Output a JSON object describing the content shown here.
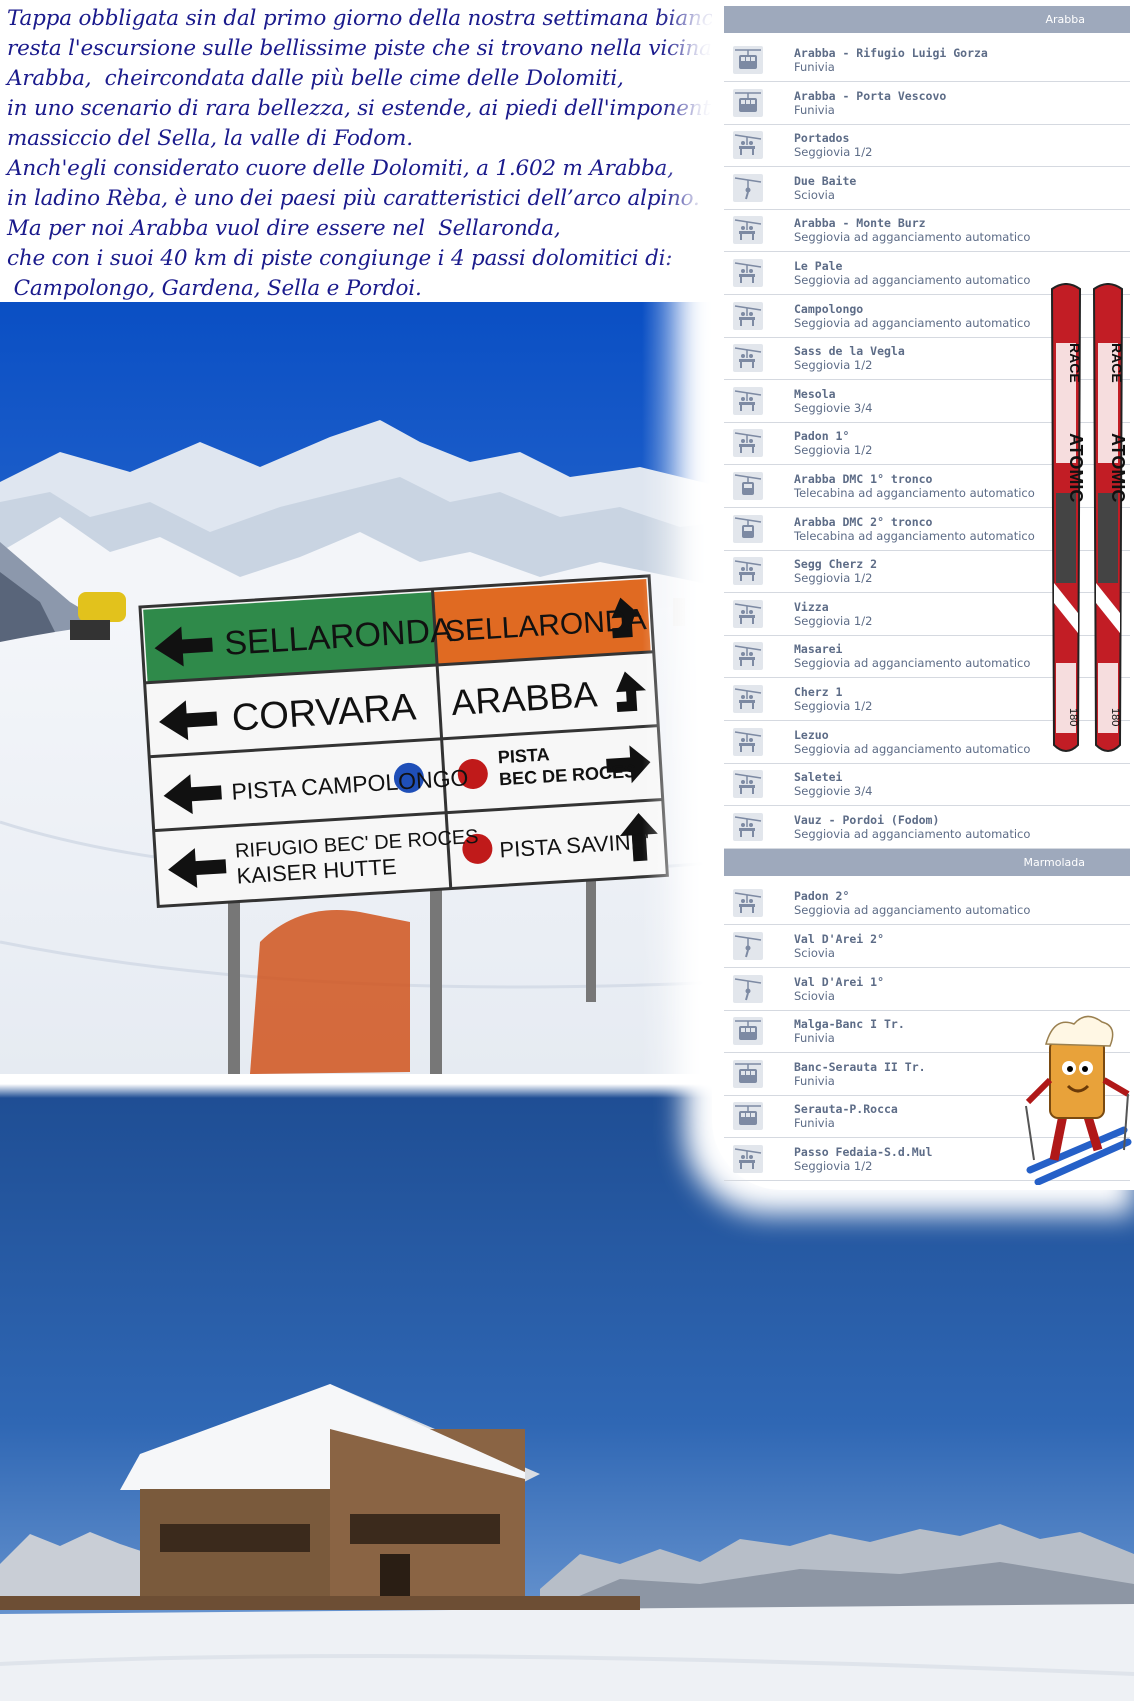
{
  "intro": {
    "lines": [
      "Tappa obbligata sin dal primo giorno della nostra settimana bianca",
      "resta l'escursione sulle bellissime piste che si trovano nella vicina",
      "Arabba,  cheircondata dalle più belle cime delle Dolomiti,",
      "in uno scenario di rara bellezza, si estende, ai piedi dell'imponente",
      "massiccio del Sella, la valle di Fodom.",
      "Anch'egli considerato cuore delle Dolomiti, a 1.602 m Arabba,",
      "in ladino Rèba, è uno dei paesi più caratteristici dell’arco alpino.",
      "Ma per noi Arabba vuol dire essere nel  Sellaronda,",
      "che con i suoi 40 km di piste congiunge i 4 passi dolomitici di:",
      " Campolongo, Gardena, Sella e Pordoi."
    ]
  },
  "signpost": {
    "left_top": "SELLARONDA",
    "right_top": "SELLARONDA",
    "left_2": "CORVARA",
    "right_2": "ARABBA",
    "left_3": "PISTA CAMPOLONGO",
    "right_3_a": "PISTA",
    "right_3_b": "BEC DE ROCES",
    "left_4_a": "RIFUGIO BEC' DE ROCES",
    "left_4_b": "KAISER HUTTE",
    "right_4": "PISTA SAVINE'",
    "colors": {
      "green": "#2f8a4a",
      "orange": "#e06a22",
      "blue": "#1f4fb8",
      "red": "#c01a1a"
    }
  },
  "lifts": {
    "groups": [
      {
        "header": "Arabba",
        "rows": [
          {
            "name": "Arabba - Rifugio Luigi Gorza",
            "type": "Funivia",
            "icon": "cable-car-icon"
          },
          {
            "name": "Arabba - Porta Vescovo",
            "type": "Funivia",
            "icon": "cable-car-icon"
          },
          {
            "name": "Portados",
            "type": "Seggiovia 1/2",
            "icon": "chairlift-icon"
          },
          {
            "name": "Due Baite",
            "type": "Sciovia",
            "icon": "drag-lift-icon"
          },
          {
            "name": "Arabba - Monte Burz",
            "type": "Seggiovia ad agganciamento automatico",
            "icon": "chairlift-icon"
          },
          {
            "name": "Le Pale",
            "type": "Seggiovia ad agganciamento automatico",
            "icon": "chairlift-icon"
          },
          {
            "name": "Campolongo",
            "type": "Seggiovia ad agganciamento automatico",
            "icon": "chairlift-icon"
          },
          {
            "name": "Sass de la Vegla",
            "type": "Seggiovia 1/2",
            "icon": "chairlift-icon"
          },
          {
            "name": "Mesola",
            "type": "Seggiovie 3/4",
            "icon": "chairlift-icon"
          },
          {
            "name": "Padon 1°",
            "type": "Seggiovia 1/2",
            "icon": "chairlift-icon"
          },
          {
            "name": "Arabba DMC 1° tronco",
            "type": "Telecabina ad agganciamento automatico",
            "icon": "gondola-icon"
          },
          {
            "name": "Arabba DMC 2° tronco",
            "type": "Telecabina ad agganciamento automatico",
            "icon": "gondola-icon"
          },
          {
            "name": "Segg Cherz 2",
            "type": "Seggiovia 1/2",
            "icon": "chairlift-icon"
          },
          {
            "name": "Vizza",
            "type": "Seggiovia 1/2",
            "icon": "chairlift-icon"
          },
          {
            "name": "Masarei",
            "type": "Seggiovia ad agganciamento automatico",
            "icon": "chairlift-icon"
          },
          {
            "name": "Cherz 1",
            "type": "Seggiovia 1/2",
            "icon": "chairlift-icon"
          },
          {
            "name": "Lezuo",
            "type": "Seggiovia ad agganciamento automatico",
            "icon": "chairlift-icon"
          },
          {
            "name": "Saletei",
            "type": "Seggiovie 3/4",
            "icon": "chairlift-icon"
          },
          {
            "name": "Vauz - Pordoi (Fodom)",
            "type": "Seggiovia ad agganciamento automatico",
            "icon": "chairlift-icon"
          }
        ]
      },
      {
        "header": "Marmolada",
        "rows": [
          {
            "name": "Padon 2°",
            "type": "Seggiovia ad agganciamento automatico",
            "icon": "chairlift-icon"
          },
          {
            "name": "Val D'Arei 2°",
            "type": "Sciovia",
            "icon": "drag-lift-icon"
          },
          {
            "name": "Val D'Arei 1°",
            "type": "Sciovia",
            "icon": "drag-lift-icon"
          },
          {
            "name": "Malga-Banc I Tr.",
            "type": "Funivia",
            "icon": "cable-car-icon"
          },
          {
            "name": "Banc-Serauta II Tr.",
            "type": "Funivia",
            "icon": "cable-car-icon"
          },
          {
            "name": "Serauta-P.Rocca",
            "type": "Funivia",
            "icon": "cable-car-icon"
          },
          {
            "name": "Passo Fedaia-S.d.Mul",
            "type": "Seggiovia 1/2",
            "icon": "chairlift-icon"
          }
        ]
      }
    ]
  },
  "skis": {
    "brand": "ATOMIC",
    "model": "RACE",
    "number": "180"
  },
  "colors": {
    "intro_text": "#1a1a8c",
    "header_bg": "#9ea9bc",
    "lift_text": "#5d6c87",
    "sky": "#2a5ea8"
  }
}
